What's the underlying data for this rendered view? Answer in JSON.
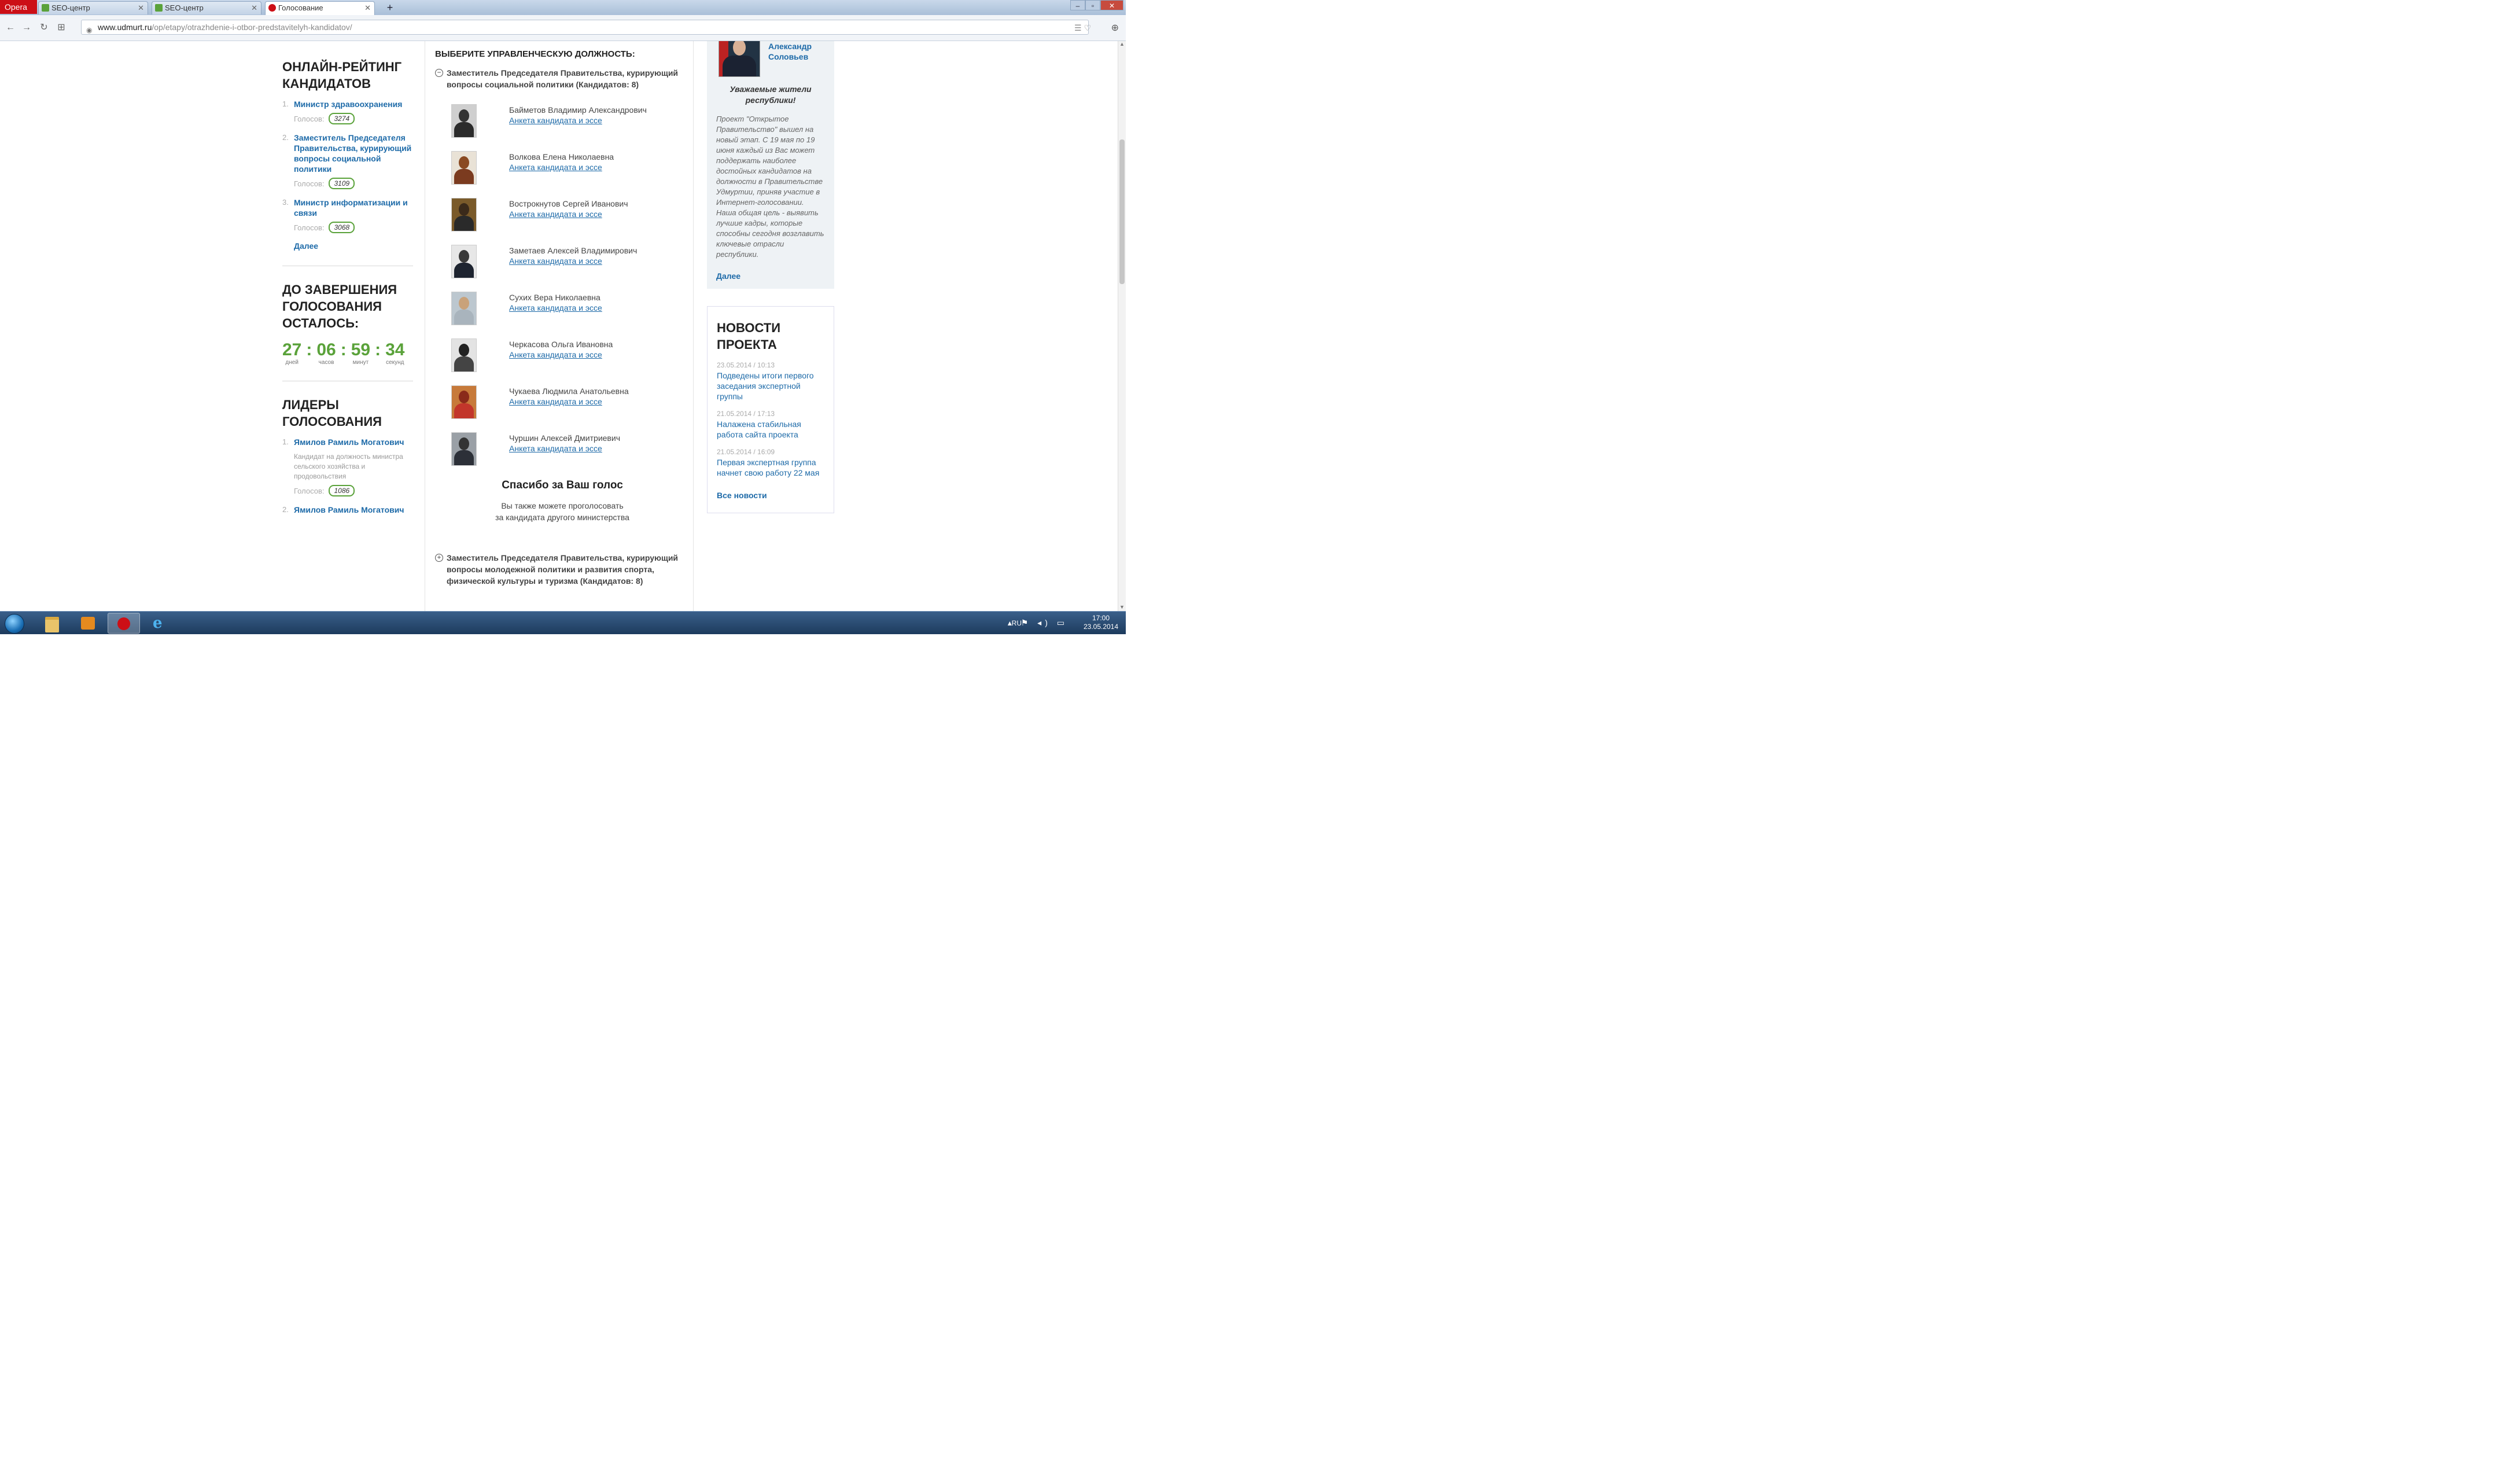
{
  "browser": {
    "opera_label": "Opera",
    "tabs": [
      {
        "title": "SEO-центр",
        "icon_color": "#5aa23a"
      },
      {
        "title": "SEO-центр",
        "icon_color": "#5aa23a"
      },
      {
        "title": "Голосование",
        "icon_color": "#cc0f16"
      }
    ],
    "new_tab": "+",
    "url_domain": "www.udmurt.ru",
    "url_path": "/op/etapy/otrazhdenie-i-otbor-predstavitelyh-kandidatov/"
  },
  "left": {
    "rating_title": "ОНЛАЙН-РЕЙТИНГ КАНДИДАТОВ",
    "votes_label": "Голосов:",
    "rating": [
      {
        "num": "1.",
        "title": "Министр здравоохранения",
        "votes": "3274"
      },
      {
        "num": "2.",
        "title": "Заместитель Председателя Правительства, курирующий вопросы социальной политики",
        "votes": "3109"
      },
      {
        "num": "3.",
        "title": "Министр информатизации и связи",
        "votes": "3068"
      }
    ],
    "more": "Далее",
    "countdown_title": "ДО ЗАВЕРШЕНИЯ ГОЛОСОВАНИЯ ОСТАЛОСЬ:",
    "countdown": {
      "days": "27",
      "hours": "06",
      "minutes": "59",
      "seconds": "34",
      "days_label": "дней",
      "hours_label": "часов",
      "minutes_label": "минут",
      "seconds_label": "секунд"
    },
    "leaders_title": "ЛИДЕРЫ ГОЛОСОВАНИЯ",
    "leaders": [
      {
        "num": "1.",
        "name": "Ямилов Рамиль Могатович",
        "desc": "Кандидат на должность министра сельского хозяйства и продовольствия",
        "votes": "1086"
      },
      {
        "num": "2.",
        "name": "Ямилов Рамиль Могатович"
      }
    ]
  },
  "center": {
    "section_title": "ВЫБЕРИТЕ УПРАВЛЕНЧЕСКУЮ ДОЛЖНОСТЬ:",
    "post1": "Заместитель Председателя Правительства, курирующий вопросы социальной политики (Кандидатов: 8)",
    "candidate_link": "Анкета кандидата и эссе",
    "candidates": [
      {
        "name": "Байметов Владимир Александрович",
        "bg": "#cfcfcf",
        "hair": "#333",
        "suit": "#2b2b2b"
      },
      {
        "name": "Волкова Елена Николаевна",
        "bg": "#e9e2d6",
        "hair": "#8a4a22",
        "suit": "#7b3b1f"
      },
      {
        "name": "Вострокнутов Сергей Иванович",
        "bg": "#7a5a2a",
        "hair": "#3b2a1a",
        "suit": "#2a2a2a"
      },
      {
        "name": "Заметаев Алексей Владимирович",
        "bg": "#e7e7e7",
        "hair": "#3a3a3a",
        "suit": "#1e2430"
      },
      {
        "name": "Сухих Вера Николаевна",
        "bg": "#bcc7cf",
        "hair": "#c9a27a",
        "suit": "#a9b4bd"
      },
      {
        "name": "Черкасова Ольга Ивановна",
        "bg": "#e3e3e3",
        "hair": "#222",
        "suit": "#444"
      },
      {
        "name": "Чукаева Людмила Анатольевна",
        "bg": "#c77a3a",
        "hair": "#8a2a1a",
        "suit": "#c2362b"
      },
      {
        "name": "Чуршин Алексей Дмитриевич",
        "bg": "#9aa0a6",
        "hair": "#333",
        "suit": "#2c3038"
      }
    ],
    "thanks_title": "Спасибо за Ваш голос",
    "thanks_line1": "Вы также можете проголосовать",
    "thanks_line2": "за кандидата другого министерства",
    "post2": "Заместитель Председателя Правительства, курирующий вопросы молодежной политики и развития спорта, физической культуры и туризма (Кандидатов: 8)"
  },
  "right": {
    "gov_name_line1": "Александр",
    "gov_name_line2": "Соловьев",
    "greeting": "Уважаемые жители республики!",
    "text": "Проект \"Открытое Правительство\" вышел на новый этап. С 19 мая по 19 июня каждый из Вас может поддержать наиболее достойных кандидатов на должности в Правительстве Удмуртии, приняв участие в Интернет-голосовании. Наша общая цель - выявить лучшие кадры, которые способны сегодня возглавить ключевые отрасли республики.",
    "more": "Далее",
    "news_title": "НОВОСТИ ПРОЕКТА",
    "news": [
      {
        "date": "23.05.2014 / 10:13",
        "title": "Подведены итоги первого заседания экспертной группы"
      },
      {
        "date": "21.05.2014 / 17:13",
        "title": "Налажена стабильная работа сайта проекта"
      },
      {
        "date": "21.05.2014 / 16:09",
        "title": "Первая экспертная группа начнет свою работу 22 мая"
      }
    ],
    "all_news": "Все новости"
  },
  "taskbar": {
    "lang": "RU",
    "time": "17:00",
    "date": "23.05.2014"
  }
}
